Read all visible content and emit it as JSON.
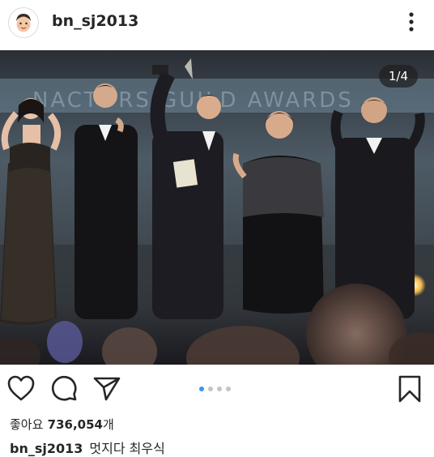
{
  "post": {
    "username": "bn_sj2013",
    "image_counter": "1/4",
    "likes_label": "좋아요",
    "likes_count": "736,054",
    "likes_suffix": "개",
    "caption_user": "bn_sj2013",
    "caption_text": "멋지다 최우식",
    "carousel": {
      "total": 4,
      "active": 1
    }
  },
  "image": {
    "description_words": "NACTORS GUILD AWARDS"
  },
  "colors": {
    "accent": "#3897f0",
    "text": "#262626",
    "inactive_dot": "#c4c4c4"
  },
  "icons": {
    "more": "more-vertical-icon",
    "like": "heart-icon",
    "comment": "comment-icon",
    "share": "send-icon",
    "save": "bookmark-icon"
  }
}
